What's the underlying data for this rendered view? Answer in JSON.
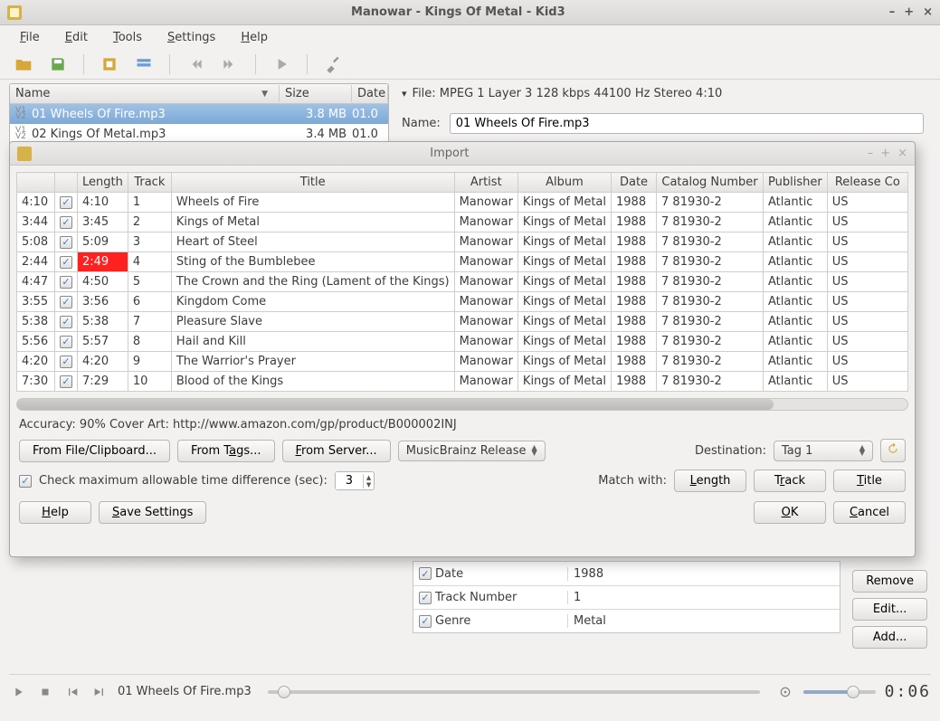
{
  "window": {
    "title": "Manowar - Kings Of Metal - Kid3"
  },
  "menu": {
    "file": "File",
    "edit": "Edit",
    "tools": "Tools",
    "settings": "Settings",
    "help": "Help"
  },
  "filetree": {
    "headers": {
      "name": "Name",
      "size": "Size",
      "date": "Date"
    },
    "rows": [
      {
        "name": "01 Wheels Of Fire.mp3",
        "size": "3.8 MB",
        "date": "01.0",
        "selected": true
      },
      {
        "name": "02 Kings Of Metal.mp3",
        "size": "3.4 MB",
        "date": "01.0",
        "selected": false
      }
    ]
  },
  "right": {
    "file_info": "File: MPEG 1 Layer 3 128 kbps 44100 Hz Stereo 4:10",
    "name_label": "Name:",
    "name_value": "01 Wheels Of Fire.mp3"
  },
  "import": {
    "title": "Import",
    "headers": [
      "",
      "",
      "Length",
      "Track",
      "Title",
      "Artist",
      "Album",
      "Date",
      "Catalog Number",
      "Publisher",
      "Release Co"
    ],
    "rows": [
      {
        "dur": "4:10",
        "len": "4:10",
        "track": "1",
        "title": "Wheels of Fire",
        "artist": "Manowar",
        "album": "Kings of Metal",
        "date": "1988",
        "cat": "7 81930-2",
        "pub": "Atlantic",
        "rel": "US",
        "mismatch": false
      },
      {
        "dur": "3:44",
        "len": "3:45",
        "track": "2",
        "title": "Kings of Metal",
        "artist": "Manowar",
        "album": "Kings of Metal",
        "date": "1988",
        "cat": "7 81930-2",
        "pub": "Atlantic",
        "rel": "US",
        "mismatch": false
      },
      {
        "dur": "5:08",
        "len": "5:09",
        "track": "3",
        "title": "Heart of Steel",
        "artist": "Manowar",
        "album": "Kings of Metal",
        "date": "1988",
        "cat": "7 81930-2",
        "pub": "Atlantic",
        "rel": "US",
        "mismatch": false
      },
      {
        "dur": "2:44",
        "len": "2:49",
        "track": "4",
        "title": "Sting of the Bumblebee",
        "artist": "Manowar",
        "album": "Kings of Metal",
        "date": "1988",
        "cat": "7 81930-2",
        "pub": "Atlantic",
        "rel": "US",
        "mismatch": true
      },
      {
        "dur": "4:47",
        "len": "4:50",
        "track": "5",
        "title": "The Crown and the Ring (Lament of the Kings)",
        "artist": "Manowar",
        "album": "Kings of Metal",
        "date": "1988",
        "cat": "7 81930-2",
        "pub": "Atlantic",
        "rel": "US",
        "mismatch": false
      },
      {
        "dur": "3:55",
        "len": "3:56",
        "track": "6",
        "title": "Kingdom Come",
        "artist": "Manowar",
        "album": "Kings of Metal",
        "date": "1988",
        "cat": "7 81930-2",
        "pub": "Atlantic",
        "rel": "US",
        "mismatch": false
      },
      {
        "dur": "5:38",
        "len": "5:38",
        "track": "7",
        "title": "Pleasure Slave",
        "artist": "Manowar",
        "album": "Kings of Metal",
        "date": "1988",
        "cat": "7 81930-2",
        "pub": "Atlantic",
        "rel": "US",
        "mismatch": false
      },
      {
        "dur": "5:56",
        "len": "5:57",
        "track": "8",
        "title": "Hail and Kill",
        "artist": "Manowar",
        "album": "Kings of Metal",
        "date": "1988",
        "cat": "7 81930-2",
        "pub": "Atlantic",
        "rel": "US",
        "mismatch": false
      },
      {
        "dur": "4:20",
        "len": "4:20",
        "track": "9",
        "title": "The Warrior's Prayer",
        "artist": "Manowar",
        "album": "Kings of Metal",
        "date": "1988",
        "cat": "7 81930-2",
        "pub": "Atlantic",
        "rel": "US",
        "mismatch": false
      },
      {
        "dur": "7:30",
        "len": "7:29",
        "track": "10",
        "title": "Blood of the Kings",
        "artist": "Manowar",
        "album": "Kings of Metal",
        "date": "1988",
        "cat": "7 81930-2",
        "pub": "Atlantic",
        "rel": "US",
        "mismatch": false
      }
    ],
    "status": "Accuracy:  90%    Cover Art:   http://www.amazon.com/gp/product/B000002INJ",
    "btn_from_file": "From File/Clipboard...",
    "btn_from_tags": "From Tags...",
    "btn_from_server": "From Server...",
    "combo_source": "MusicBrainz Release",
    "dest_label": "Destination:",
    "dest_value": "Tag 1",
    "check_label": "Check maximum allowable time difference (sec):",
    "diff_value": "3",
    "match_label": "Match with:",
    "btn_length": "Length",
    "btn_track": "Track",
    "btn_title": "Title",
    "btn_help": "Help",
    "btn_save": "Save Settings",
    "btn_ok": "OK",
    "btn_cancel": "Cancel"
  },
  "tags": {
    "rows": [
      {
        "key": "Date",
        "val": "1988"
      },
      {
        "key": "Track Number",
        "val": "1"
      },
      {
        "key": "Genre",
        "val": "Metal"
      }
    ],
    "btn_remove": "Remove",
    "btn_edit": "Edit...",
    "btn_add": "Add..."
  },
  "player": {
    "now_playing": "01 Wheels Of Fire.mp3",
    "time": "0:06"
  }
}
